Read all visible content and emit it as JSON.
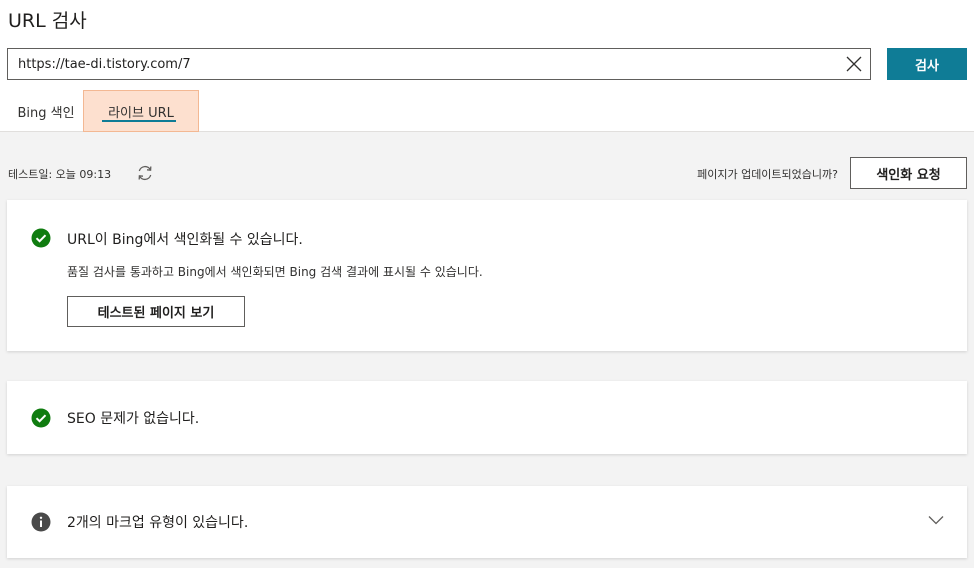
{
  "header": {
    "title": "URL 검사"
  },
  "search": {
    "url_value": "https://tae-di.tistory.com/7",
    "button_label": "검사"
  },
  "tabs": [
    {
      "label": "Bing 색인",
      "active": false
    },
    {
      "label": "라이브 URL",
      "active": true
    }
  ],
  "toolbar": {
    "test_date": "테스트일: 오늘 09:13",
    "updated_question": "페이지가 업데이트되었습니까?",
    "request_index_label": "색인화 요청"
  },
  "cards": {
    "indexable": {
      "title": "URL이 Bing에서 색인화될 수 있습니다.",
      "description": "품질 검사를 통과하고 Bing에서 색인화되면 Bing 검색 결과에 표시될 수 있습니다.",
      "button_label": "테스트된 페이지 보기",
      "icon": "check-circle-icon"
    },
    "seo": {
      "title": "SEO 문제가 없습니다.",
      "icon": "check-circle-icon"
    },
    "markup": {
      "title": "2개의 마크업 유형이 있습니다.",
      "icon": "info-circle-icon"
    }
  },
  "colors": {
    "accent": "#0f7c96",
    "success": "#107c10",
    "info": "#4a4a4a",
    "active_tab_bg": "#fde0cf"
  }
}
